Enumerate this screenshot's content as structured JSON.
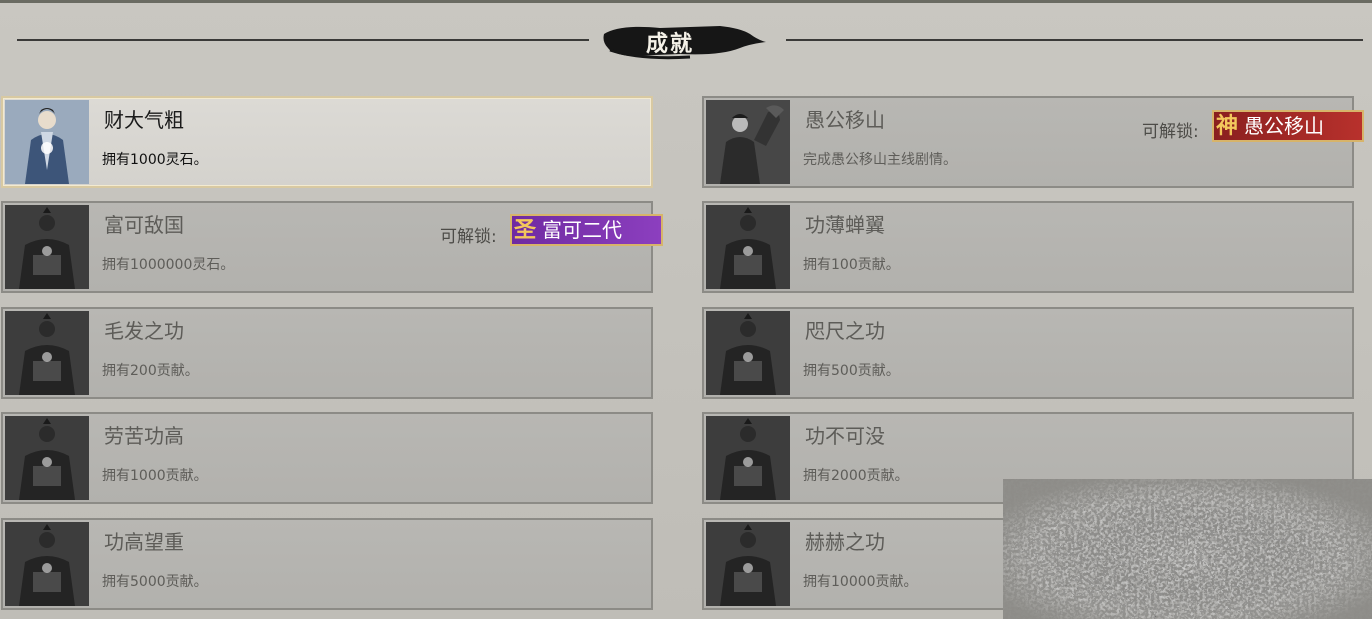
{
  "header": {
    "title": "成就"
  },
  "achievements": [
    {
      "name": "财大气粗",
      "desc": "拥有1000灵石。"
    },
    {
      "name": "愚公移山",
      "desc": "完成愚公移山主线剧情。",
      "unlock_label": "可解锁:",
      "reward": "愚公移山",
      "reward_glyph": "神",
      "reward_color": "#b8312c"
    },
    {
      "name": "富可敌国",
      "desc": "拥有1000000灵石。",
      "unlock_label": "可解锁:",
      "reward": "富可二代",
      "reward_glyph": "圣",
      "reward_color": "#8c3fbf"
    },
    {
      "name": "功薄蝉翼",
      "desc": "拥有100贡献。"
    },
    {
      "name": "毛发之功",
      "desc": "拥有200贡献。"
    },
    {
      "name": "咫尺之功",
      "desc": "拥有500贡献。"
    },
    {
      "name": "劳苦功高",
      "desc": "拥有1000贡献。"
    },
    {
      "name": "功不可没",
      "desc": "拥有2000贡献。"
    },
    {
      "name": "功高望重",
      "desc": "拥有5000贡献。"
    },
    {
      "name": "赫赫之功",
      "desc": "拥有10000贡献。"
    }
  ],
  "colors": {
    "background": "#c6c4be",
    "unlocked_border": "#d8c9a2",
    "locked_border": "#8c8b86"
  }
}
